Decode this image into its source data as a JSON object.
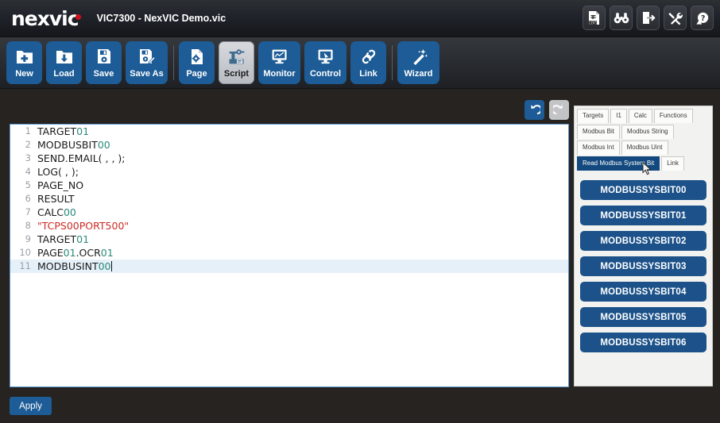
{
  "titlebar": {
    "logo_text": "nexvic",
    "window_title": "VIC7300 - NexVIC Demo.vic",
    "icons": [
      {
        "name": "log-icon",
        "label": "LOG"
      },
      {
        "name": "binoculars-icon",
        "label": "Monitor"
      },
      {
        "name": "exit-door-icon",
        "label": "Exit"
      },
      {
        "name": "tools-icon",
        "label": "Tools"
      },
      {
        "name": "help-question-icon",
        "label": "Help"
      }
    ]
  },
  "toolbar": {
    "buttons": [
      {
        "label": "New",
        "icon": "new-folder-icon",
        "active": false
      },
      {
        "label": "Load",
        "icon": "load-folder-icon",
        "active": false
      },
      {
        "label": "Save",
        "icon": "floppy-icon",
        "active": false
      },
      {
        "label": "Save As",
        "icon": "floppy-pencil-icon",
        "active": false
      },
      {
        "label": "Page",
        "icon": "page-gear-icon",
        "active": false
      },
      {
        "label": "Script",
        "icon": "script-machine-icon",
        "active": true
      },
      {
        "label": "Monitor",
        "icon": "monitor-chart-icon",
        "active": false
      },
      {
        "label": "Control",
        "icon": "control-screen-icon",
        "active": false
      },
      {
        "label": "Link",
        "icon": "chain-link-icon",
        "active": false
      },
      {
        "label": "Wizard",
        "icon": "magic-wand-icon",
        "active": false
      }
    ]
  },
  "history": {
    "undo_label": "Undo",
    "undo_enabled": true,
    "redo_label": "Redo",
    "redo_enabled": false
  },
  "editor": {
    "lines": [
      {
        "n": "1",
        "tokens": [
          {
            "t": "TARGET",
            "c": "plain"
          },
          {
            "t": "01",
            "c": "num"
          }
        ]
      },
      {
        "n": "2",
        "tokens": [
          {
            "t": "MODBUSBIT",
            "c": "plain"
          },
          {
            "t": "00",
            "c": "num"
          }
        ]
      },
      {
        "n": "3",
        "tokens": [
          {
            "t": "SEND.EMAIL( , , );",
            "c": "plain"
          }
        ]
      },
      {
        "n": "4",
        "tokens": [
          {
            "t": "LOG( , );",
            "c": "plain"
          }
        ]
      },
      {
        "n": "5",
        "tokens": [
          {
            "t": "PAGE_NO",
            "c": "plain"
          }
        ]
      },
      {
        "n": "6",
        "tokens": [
          {
            "t": "RESULT",
            "c": "plain"
          }
        ]
      },
      {
        "n": "7",
        "tokens": [
          {
            "t": "CALC",
            "c": "plain"
          },
          {
            "t": "00",
            "c": "num"
          }
        ]
      },
      {
        "n": "8",
        "tokens": [
          {
            "t": "\"TCPS00PORT500\"",
            "c": "str"
          }
        ]
      },
      {
        "n": "9",
        "tokens": [
          {
            "t": "TARGET",
            "c": "plain"
          },
          {
            "t": "01",
            "c": "num"
          }
        ]
      },
      {
        "n": "10",
        "tokens": [
          {
            "t": "PAGE",
            "c": "plain"
          },
          {
            "t": "01",
            "c": "num"
          },
          {
            "t": ".OCR",
            "c": "plain"
          },
          {
            "t": "01",
            "c": "num"
          }
        ]
      },
      {
        "n": "11",
        "tokens": [
          {
            "t": "MODBUSINT",
            "c": "plain"
          },
          {
            "t": "00",
            "c": "num"
          }
        ],
        "current": true,
        "caret": true
      }
    ]
  },
  "panel": {
    "tabs": [
      {
        "label": "Targets",
        "selected": false
      },
      {
        "label": "I1",
        "selected": false
      },
      {
        "label": "Calc",
        "selected": false
      },
      {
        "label": "Functions",
        "selected": false
      },
      {
        "label": "Modbus Bit",
        "selected": false
      },
      {
        "label": "Modbus String",
        "selected": false
      },
      {
        "label": "Modbus Int",
        "selected": false
      },
      {
        "label": "Modbus Uint",
        "selected": false
      },
      {
        "label": "Read Modbus System Bit",
        "selected": true
      },
      {
        "label": "Link",
        "selected": false
      }
    ],
    "items": [
      "MODBUSSYSBIT00",
      "MODBUSSYSBIT01",
      "MODBUSSYSBIT02",
      "MODBUSSYSBIT03",
      "MODBUSSYSBIT04",
      "MODBUSSYSBIT05",
      "MODBUSSYSBIT06"
    ]
  },
  "footer": {
    "apply_label": "Apply"
  },
  "colors": {
    "accent_blue": "#1d5c96",
    "tab_selected": "#13497e",
    "item_blue": "#1c5289",
    "string_red": "#cc2a22",
    "number_teal": "#2a8a7a",
    "chrome_dark": "#262320"
  }
}
